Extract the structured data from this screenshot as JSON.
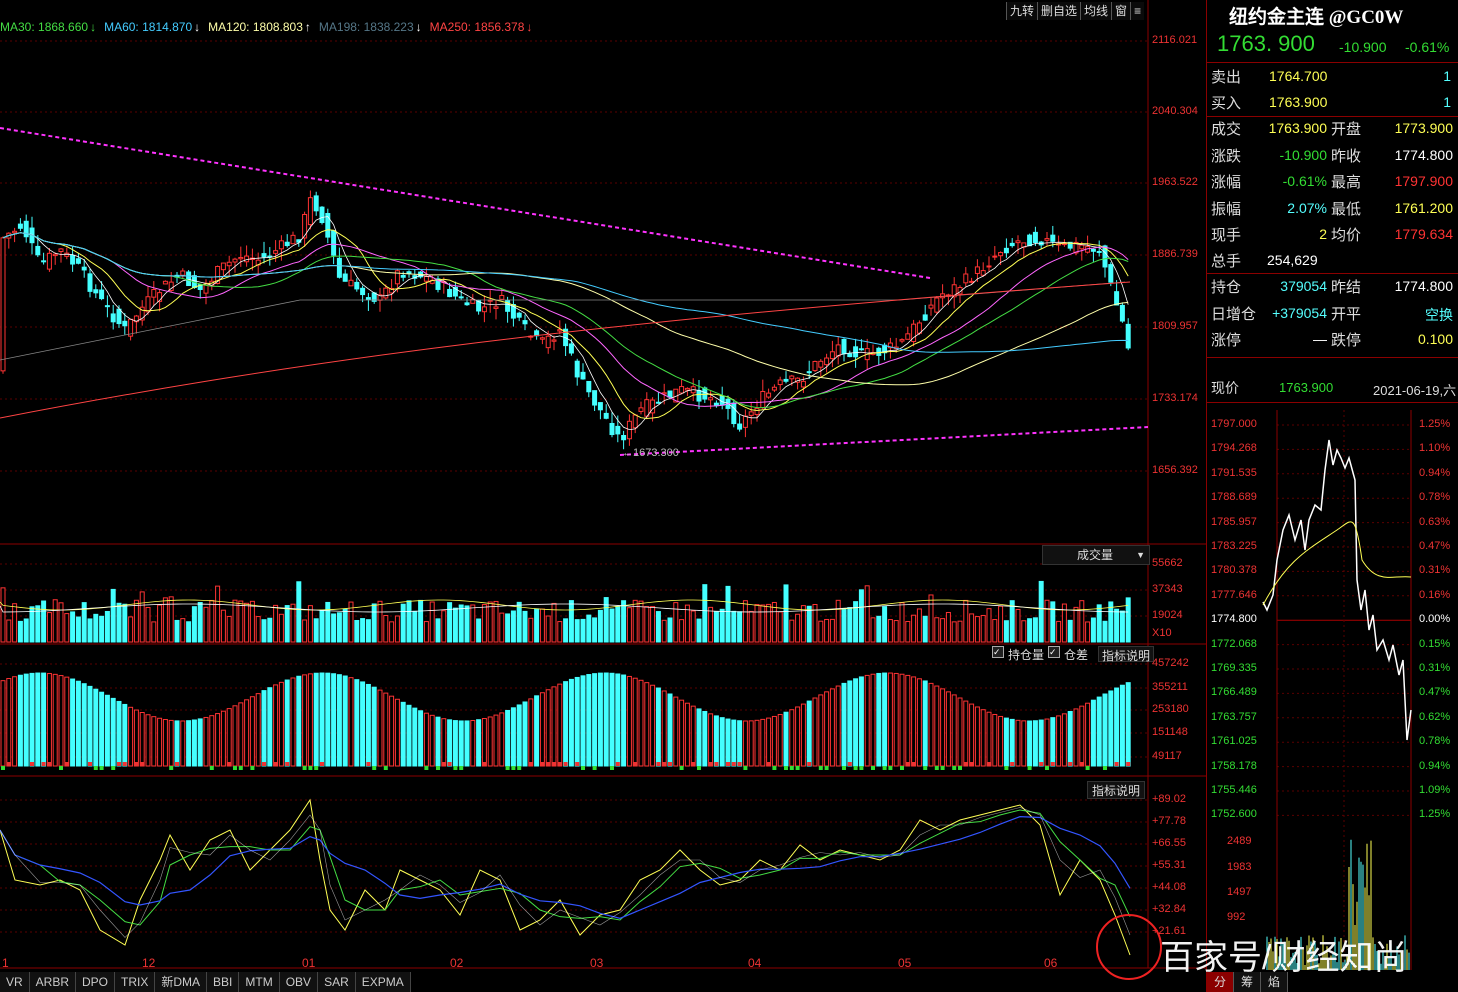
{
  "toolbar": [
    "九转",
    "删自选",
    "均线",
    "窗",
    "≡"
  ],
  "ma_legend": [
    {
      "label": "MA30: 1868.660",
      "color": "#44dd44"
    },
    {
      "label": "MA60: 1814.870",
      "color": "#44ccff"
    },
    {
      "label": "MA120: 1808.803",
      "color": "#ffffaa"
    },
    {
      "label": "MA198: 1838.223",
      "color": "#557788"
    },
    {
      "label": "MA250: 1856.378",
      "color": "#ff4444"
    }
  ],
  "price_axis": [
    "2116.021",
    "2040.304",
    "1963.522",
    "1886.739",
    "1809.957",
    "1733.174",
    "1656.392"
  ],
  "low_label": "1673.300",
  "vol_header": "成交量",
  "vol_axis": [
    "55662",
    "37343",
    "19024",
    "X10"
  ],
  "oi_header": {
    "cb1": "持仓量",
    "cb2": "仓差",
    "btn": "指标说明"
  },
  "oi_axis": [
    "457242",
    "355211",
    "253180",
    "151148",
    "49117"
  ],
  "osc_header": "指标说明",
  "osc_axis": [
    "+89.02",
    "+77.78",
    "+66.55",
    "+55.31",
    "+44.08",
    "+32.84",
    "+21.61"
  ],
  "x_labels": [
    "1",
    "12",
    "01",
    "02",
    "03",
    "04",
    "05",
    "06"
  ],
  "tabs": [
    "VR",
    "ARBR",
    "DPO",
    "TRIX",
    "新DMA",
    "BBI",
    "MTM",
    "OBV",
    "SAR",
    "EXPMA"
  ],
  "quote": {
    "title": "纽约金主连 @GC0W",
    "price": "1763. 900",
    "change": "-10.900",
    "pct": "-0.61%",
    "sell_label": "卖出",
    "sell_price": "1764.700",
    "sell_vol": "1",
    "buy_label": "买入",
    "buy_price": "1763.900",
    "buy_vol": "1",
    "rows": [
      {
        "k1": "成交",
        "v1": "1763.900",
        "c1": "#ffff55",
        "k2": "开盘",
        "v2": "1773.900",
        "c2": "#ffff55"
      },
      {
        "k1": "涨跌",
        "v1": "-10.900",
        "c1": "#33dd33",
        "k2": "昨收",
        "v2": "1774.800",
        "c2": "#ffffff"
      },
      {
        "k1": "涨幅",
        "v1": "-0.61%",
        "c1": "#33dd33",
        "k2": "最高",
        "v2": "1797.900",
        "c2": "#ff3333"
      },
      {
        "k1": "振幅",
        "v1": "2.07%",
        "c1": "#55ffff",
        "k2": "最低",
        "v2": "1761.200",
        "c2": "#ffff55"
      },
      {
        "k1": "现手",
        "v1": "2",
        "c1": "#ffff55",
        "k2": "均价",
        "v2": "1779.634",
        "c2": "#ff3333"
      }
    ],
    "total_label": "总手",
    "total_value": "254,629",
    "rows2": [
      {
        "k1": "持仓",
        "v1": "379054",
        "c1": "#55ffff",
        "k2": "昨结",
        "v2": "1774.800",
        "c2": "#ffffff"
      },
      {
        "k1": "日增仓",
        "v1": "+379054",
        "c1": "#55ffff",
        "k2": "开平",
        "v2": "空换",
        "c2": "#55ffff"
      },
      {
        "k1": "涨停",
        "v1": "—",
        "c1": "#ffffff",
        "k2": "跌停",
        "v2": "0.100",
        "c2": "#ffff55"
      }
    ],
    "now_label": "现价",
    "now_value": "1763.900",
    "date": "2021-06-19,六"
  },
  "mini_left": [
    "1797.000",
    "1794.268",
    "1791.535",
    "1788.689",
    "1785.957",
    "1783.225",
    "1780.378",
    "1777.646",
    "1774.800",
    "1772.068",
    "1769.335",
    "1766.489",
    "1763.757",
    "1761.025",
    "1758.178",
    "1755.446",
    "1752.600"
  ],
  "mini_right": [
    "1.25%",
    "1.10%",
    "0.94%",
    "0.78%",
    "0.63%",
    "0.47%",
    "0.31%",
    "0.16%",
    "0.00%",
    "0.15%",
    "0.31%",
    "0.47%",
    "0.62%",
    "0.78%",
    "0.94%",
    "1.09%",
    "1.25%"
  ],
  "mini_vol": [
    "2489",
    "1983",
    "1497",
    "992"
  ],
  "mini_tabs": [
    "分",
    "筹",
    "焰"
  ],
  "watermark": "百家号/财经知尚",
  "colors": {
    "up": "#ff3333",
    "down": "#44ffff",
    "ma5": "#ffffff",
    "ma10": "#ffff55",
    "ma20": "#ff66ff",
    "ma30": "#44dd44",
    "ma60": "#44ccff",
    "ma250": "#ff4444",
    "trend": "#ff33ff"
  }
}
